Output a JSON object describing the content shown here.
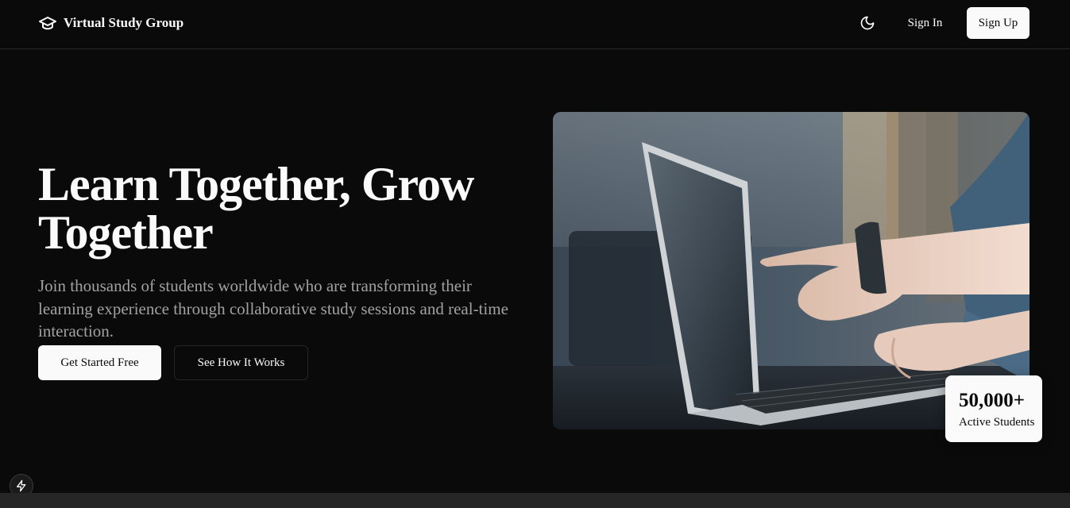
{
  "header": {
    "brand_name": "Virtual Study Group",
    "brand_icon": "graduation-cap-icon",
    "theme_icon": "moon-icon",
    "signin_label": "Sign In",
    "signup_label": "Sign Up"
  },
  "hero": {
    "title": "Learn Together, Grow Together",
    "subtitle": "Join thousands of students worldwide who are transforming their learning experience through collaborative study sessions and real-time interaction.",
    "primary_cta": "Get Started Free",
    "secondary_cta": "See How It Works",
    "image_subject": "hands-pointing-at-laptop-screen"
  },
  "stat": {
    "value": "50,000+",
    "label": "Active Students"
  },
  "dev_badge_icon": "lightning-icon",
  "colors": {
    "background": "#0a0a0a",
    "foreground": "#fafafa",
    "muted": "#a1a1a1",
    "border": "#262626"
  }
}
